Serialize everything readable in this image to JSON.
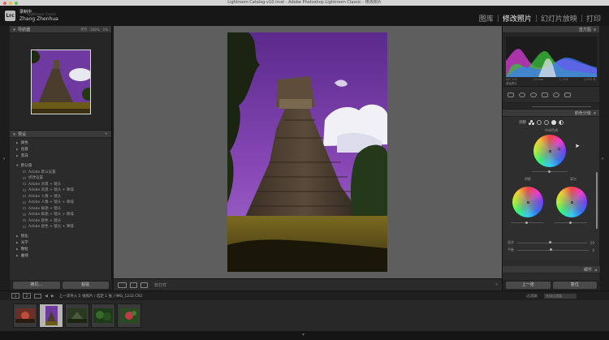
{
  "window": {
    "title": "Lightroom Catalog-v10.lrcat - Adobe Photoshop Lightroom Classic - 修改照片"
  },
  "identity": {
    "logo": "Lrc",
    "recording": "录制中",
    "catalog_sub": "Lightroom Classic",
    "user": "Zhang Zhenhua"
  },
  "modules": [
    {
      "label": "图库",
      "active": false
    },
    {
      "label": "修改照片",
      "active": true
    },
    {
      "label": "幻灯片放映",
      "active": false
    },
    {
      "label": "打印",
      "active": false
    }
  ],
  "navigator": {
    "title": "导航器",
    "zoom": [
      "适合",
      "100%",
      "1%"
    ]
  },
  "presets": {
    "title": "预设",
    "add_icon": "plus-icon",
    "top_folders": [
      "颜色",
      "创意",
      "黑白"
    ],
    "open_folder": "默认值",
    "items": [
      "Adobe 默认设置",
      "修改设置",
      "Adobe 风景 + 镜头",
      "Adobe 风景 + 镜头 + 降噪",
      "Adobe 人像 + 镜头",
      "Adobe 人像 + 镜头 + 降噪",
      "Adobe 鲜艳 + 镜头",
      "Adobe 鲜艳 + 镜头 + 降噪",
      "Adobe 颜色 + 镜头",
      "Adobe 颜色 + 镜头 + 降噪"
    ],
    "bottom_folders": [
      "锐化",
      "光学",
      "颗粒",
      "曲线"
    ]
  },
  "left_buttons": {
    "copy": "拷贝...",
    "paste": "粘贴"
  },
  "toolbar": {
    "soft_proof": "软打样"
  },
  "histogram": {
    "title": "直方图",
    "readout": [
      "ISO 100",
      "15 mm",
      "f / 5.6",
      "1/320 秒"
    ],
    "original": "原始照片"
  },
  "color_grading": {
    "title": "颜色分级",
    "adjust_label": "调整",
    "midtones_label": "中间色调",
    "shadows_label": "阴影",
    "highlights_label": "高光",
    "blending_label": "混合",
    "blending_value": "50",
    "balance_label": "平衡",
    "balance_value": "0"
  },
  "detail": {
    "title": "细节"
  },
  "right_buttons": {
    "previous": "上一张",
    "reset": "复位"
  },
  "filmstrip": {
    "page_1": "1",
    "page_2": "2",
    "path": "上一次导入  5 张照片 / 选定 1 张 / IMG_1232.CR2",
    "filter_label": "过滤器：",
    "filter_value": "关闭过滤器"
  },
  "colors": {
    "sky": "#7a3aa4",
    "grass": "#6b5a18",
    "accent": "#e0e0e0"
  }
}
